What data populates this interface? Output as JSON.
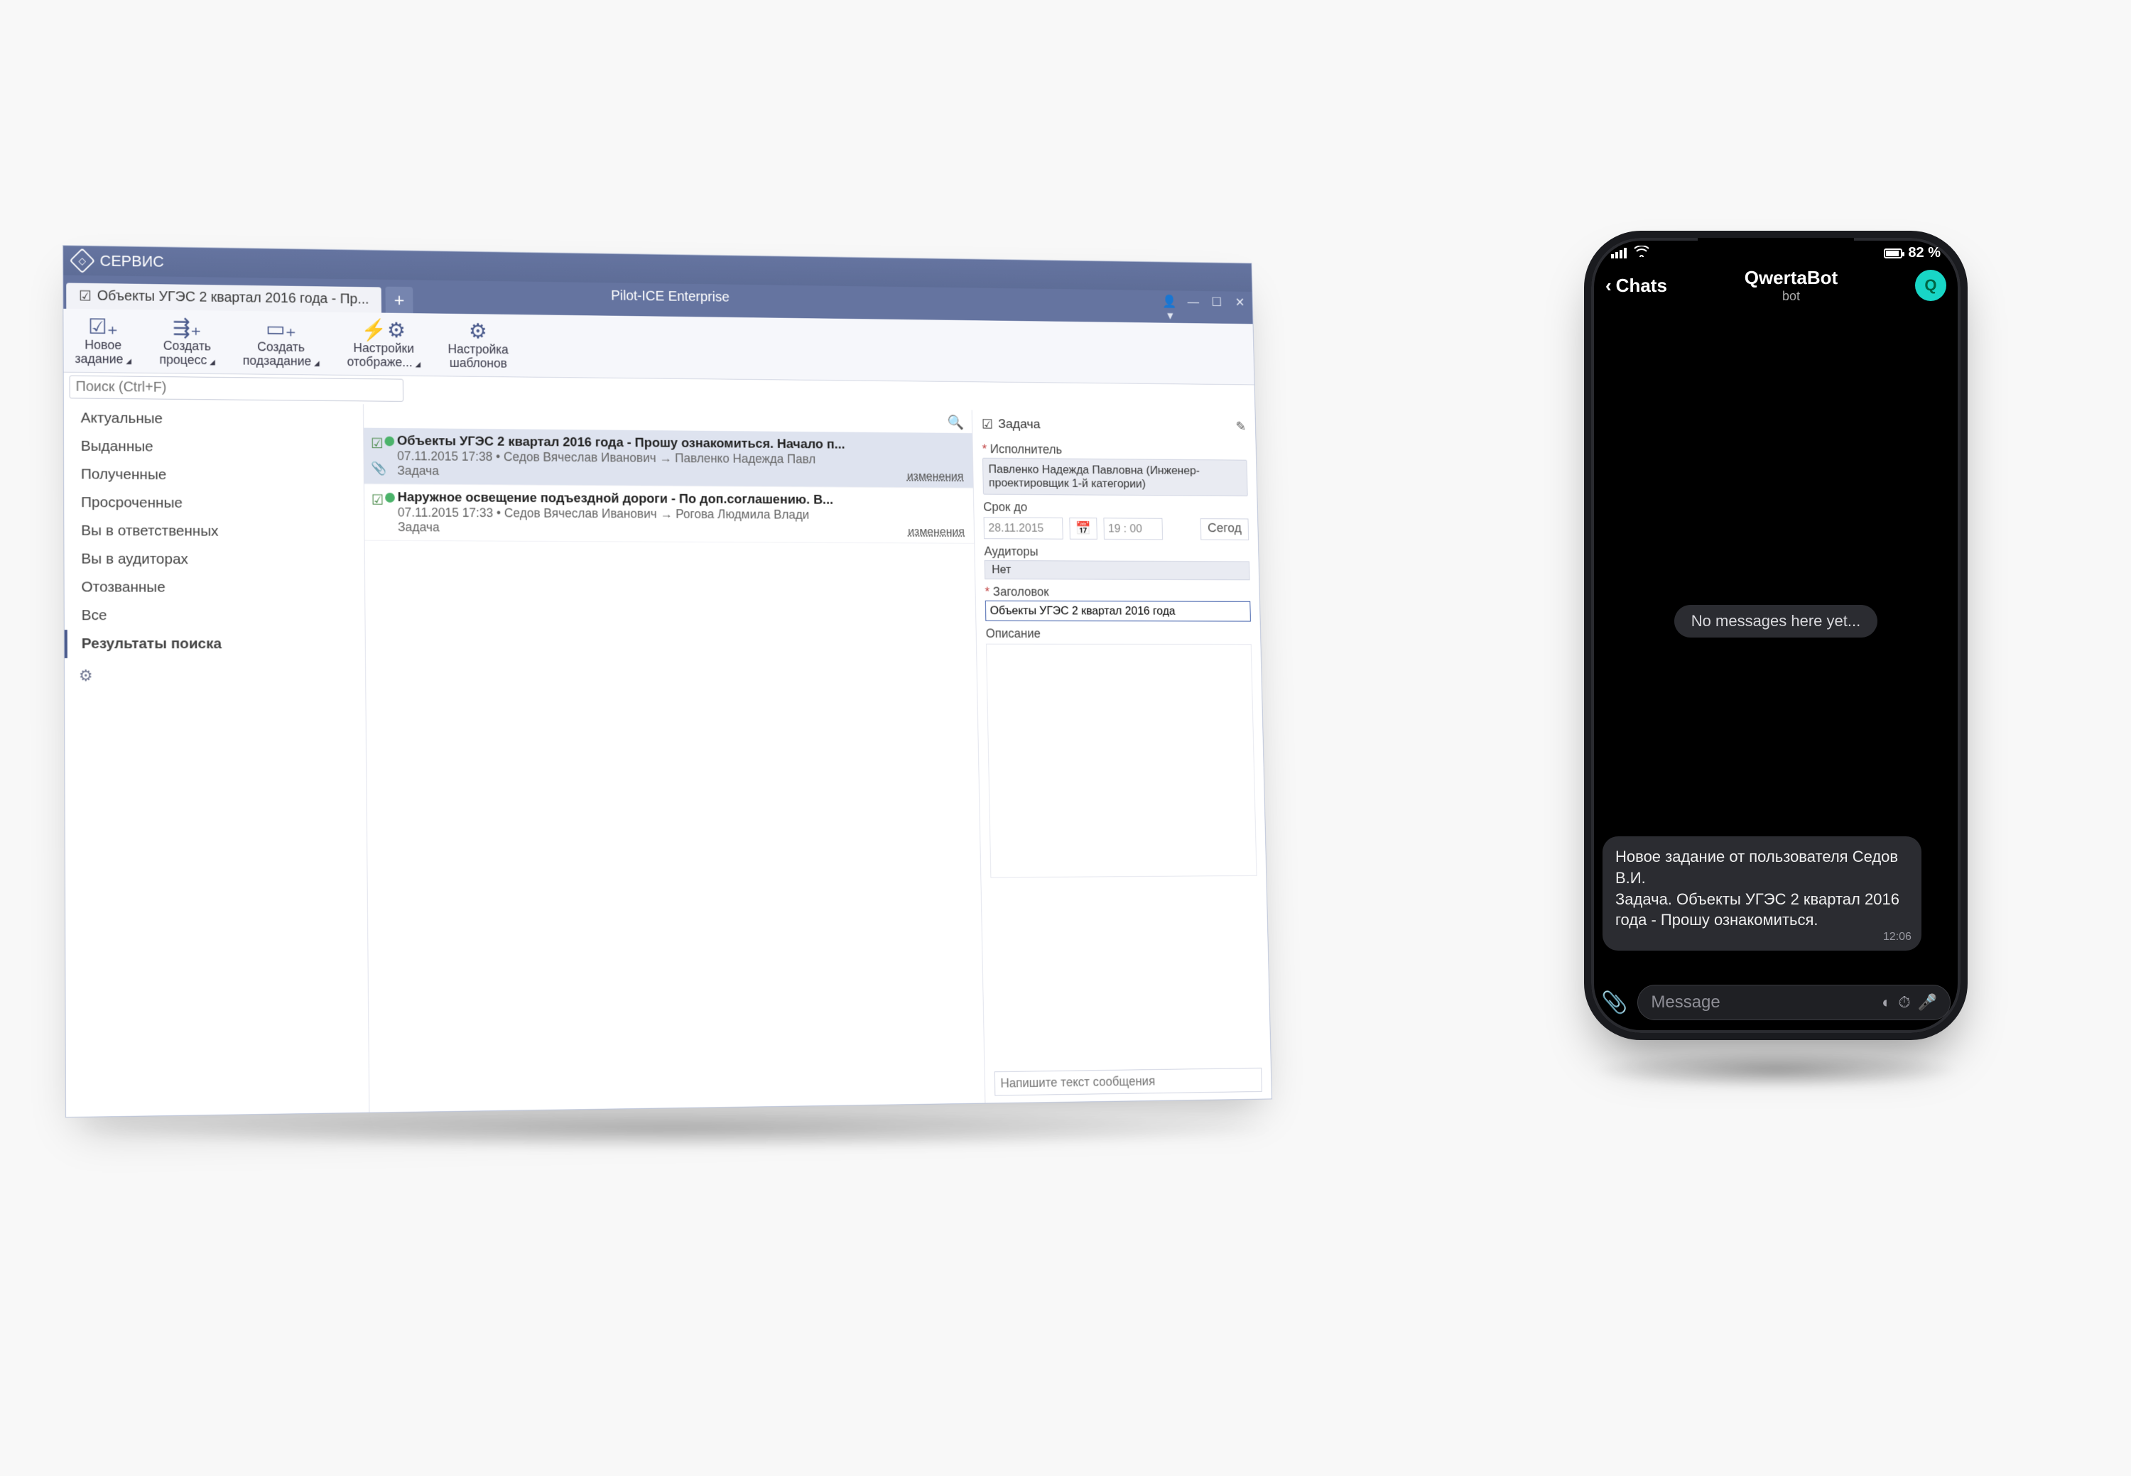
{
  "desktop": {
    "menu": "СЕРВИС",
    "tab_label": "Объекты УГЭС 2 квартал 2016 года - Пр...",
    "app_title": "Pilot-ICE Enterprise",
    "ribbon": {
      "new_task": "Новое\nзадание",
      "create_process": "Создать\nпроцесс",
      "create_subtask": "Создать\nподзадание",
      "display_settings": "Настройки\nотображе...",
      "template_settings": "Настройка\nшаблонов"
    },
    "search_placeholder": "Поиск (Ctrl+F)",
    "sidebar": {
      "items": [
        "Актуальные",
        "Выданные",
        "Полученные",
        "Просроченные",
        "Вы в ответственных",
        "Вы в аудиторах",
        "Отозванные",
        "Все",
        "Результаты поиска"
      ],
      "active_index": 8
    },
    "tasks": [
      {
        "title": "Объекты УГЭС 2 квартал 2016 года - Прошу ознакомиться.  Начало п...",
        "meta": "07.11.2015 17:38 • Седов Вячеслав Иванович → Павленко Надежда Павл",
        "type": "Задача",
        "changes": "изменения",
        "selected": true,
        "attachment": true
      },
      {
        "title": "Наружное освещение подъездной дороги - По доп.соглашению.  В...",
        "meta": "07.11.2015 17:33 • Седов Вячеслав Иванович → Рогова Людмила Влади",
        "type": "Задача",
        "changes": "изменения",
        "selected": false,
        "attachment": false
      }
    ],
    "details": {
      "header": "Задача",
      "assignee_label": "Исполнитель",
      "assignee_value": "Павленко Надежда Павловна (Инженер-проектировщик 1-й категории)",
      "due_label": "Срок до",
      "due_date": "28.11.2015",
      "due_time": "19 : 00",
      "today_btn": "Сегод",
      "auditors_label": "Аудиторы",
      "auditors_value": "Нет",
      "title_label": "Заголовок",
      "title_value": "Объекты УГЭС 2 квартал 2016 года",
      "desc_label": "Описание",
      "message_placeholder": "Напишите текст сообщения"
    }
  },
  "phone": {
    "status_battery": "82 %",
    "back": "Chats",
    "bot_name": "QwertaBot",
    "bot_sub": "bot",
    "avatar_letter": "Q",
    "no_messages": "No messages here yet...",
    "message_text": "Новое задание от пользователя Седов В.И.\nЗадача. Объекты УГЭС 2 квартал 2016 года - Прошу ознакомиться.",
    "message_time": "12:06",
    "input_placeholder": "Message"
  }
}
